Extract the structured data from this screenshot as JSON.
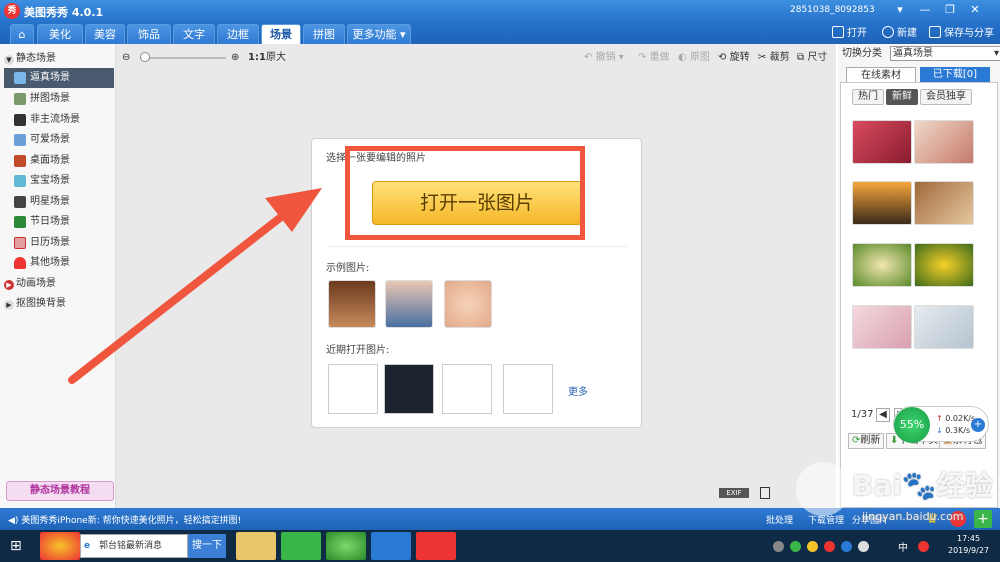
{
  "window": {
    "title": "美图秀秀 4.0.1",
    "logo_char": "秀",
    "account": "2851038_8092853",
    "controls": [
      "▾",
      "—",
      "❐",
      "✕"
    ]
  },
  "menubar": {
    "tabs": [
      "美化",
      "美容",
      "饰品",
      "文字",
      "边框",
      "场景",
      "拼图",
      "更多功能 ▾"
    ],
    "active_tab": "场景",
    "actions": {
      "open": "打开",
      "new": "新建",
      "save_share": "保存与分享"
    }
  },
  "toolbar": {
    "zoom_ratio": "1:1",
    "original_size": "原大",
    "undo": "撤销",
    "redo": "重做",
    "original": "原图",
    "rotate": "旋转",
    "crop": "裁剪",
    "size": "尺寸"
  },
  "sidebar": {
    "static_group": "静态场景",
    "items": [
      "逼真场景",
      "拼图场景",
      "非主流场景",
      "可爱场景",
      "桌面场景",
      "宝宝场景",
      "明星场景",
      "节日场景",
      "日历场景",
      "其他场景"
    ],
    "active_item": "逼真场景",
    "animated_group": "动画场景",
    "cutout_group": "抠图换背景",
    "tutorial": "静态场景教程"
  },
  "center_panel": {
    "choose_label": "选择一张要编辑的照片",
    "open_button": "打开一张图片",
    "samples_label": "示例图片:",
    "recent_label": "近期打开图片:",
    "more": "更多"
  },
  "right_panel": {
    "category_label": "切换分类",
    "category_value": "逼真场景",
    "tabs": [
      "在线素材",
      "已下载[0]"
    ],
    "filters": [
      "热门",
      "新鲜",
      "会员独享"
    ],
    "active_filter": "新鲜",
    "page": "1/37",
    "goto_label": "到",
    "page_unit": "页",
    "go": "GO",
    "refresh": "刷新",
    "download_page": "下载本页",
    "material_pack": "素材包"
  },
  "speed": {
    "percent": "55%",
    "up": "0.02K/s",
    "down": "0.3K/s"
  },
  "canvas_badges": {
    "exif": "EXIF"
  },
  "statusbar": {
    "news": "美图秀秀iPhone新: 帮你快速美化照片，轻松搞定拼图!",
    "batch": "批处理",
    "download_manager": "下载管理",
    "share": "分享图片"
  },
  "taskbar": {
    "search_placeholder": "郭台铭最新消息",
    "search_button": "搜一下",
    "time": "17:45",
    "date": "2019/9/27",
    "ime": "中"
  },
  "watermark": {
    "text": "Bai🐾经验",
    "url": "jingyan.baidu.com"
  },
  "colors": {
    "accent": "#2673cc",
    "highlight": "#f0553d",
    "button": "#f6b728"
  }
}
